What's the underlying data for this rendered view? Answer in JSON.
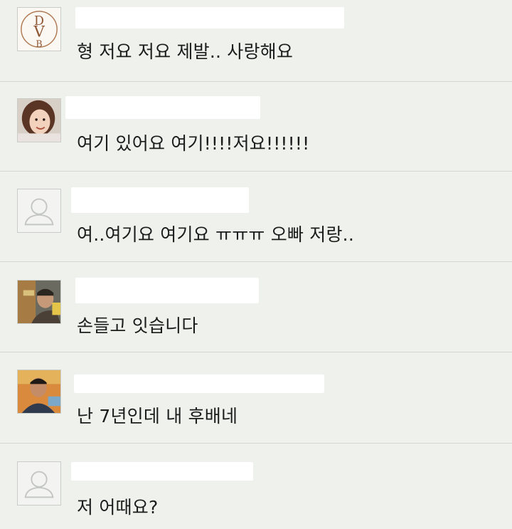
{
  "comments": [
    {
      "avatar": "monogram-logo-avatar",
      "text": "형 저요 저요 제발.. 사랑해요"
    },
    {
      "avatar": "photo-avatar-girl",
      "text": "여기 있어요 여기!!!!저요!!!!!!"
    },
    {
      "avatar": "default-user-icon",
      "text": "여..여기요 여기요 ㅠㅠㅠ 오빠 저랑.."
    },
    {
      "avatar": "photo-avatar-man",
      "text": "손들고 잇습니다"
    },
    {
      "avatar": "photo-avatar-older-man",
      "text": "난 7년인데 내 후배네"
    },
    {
      "avatar": "default-user-icon",
      "text": "저 어때요?"
    }
  ],
  "monogram": {
    "letters": [
      "D",
      "V",
      "B"
    ]
  }
}
